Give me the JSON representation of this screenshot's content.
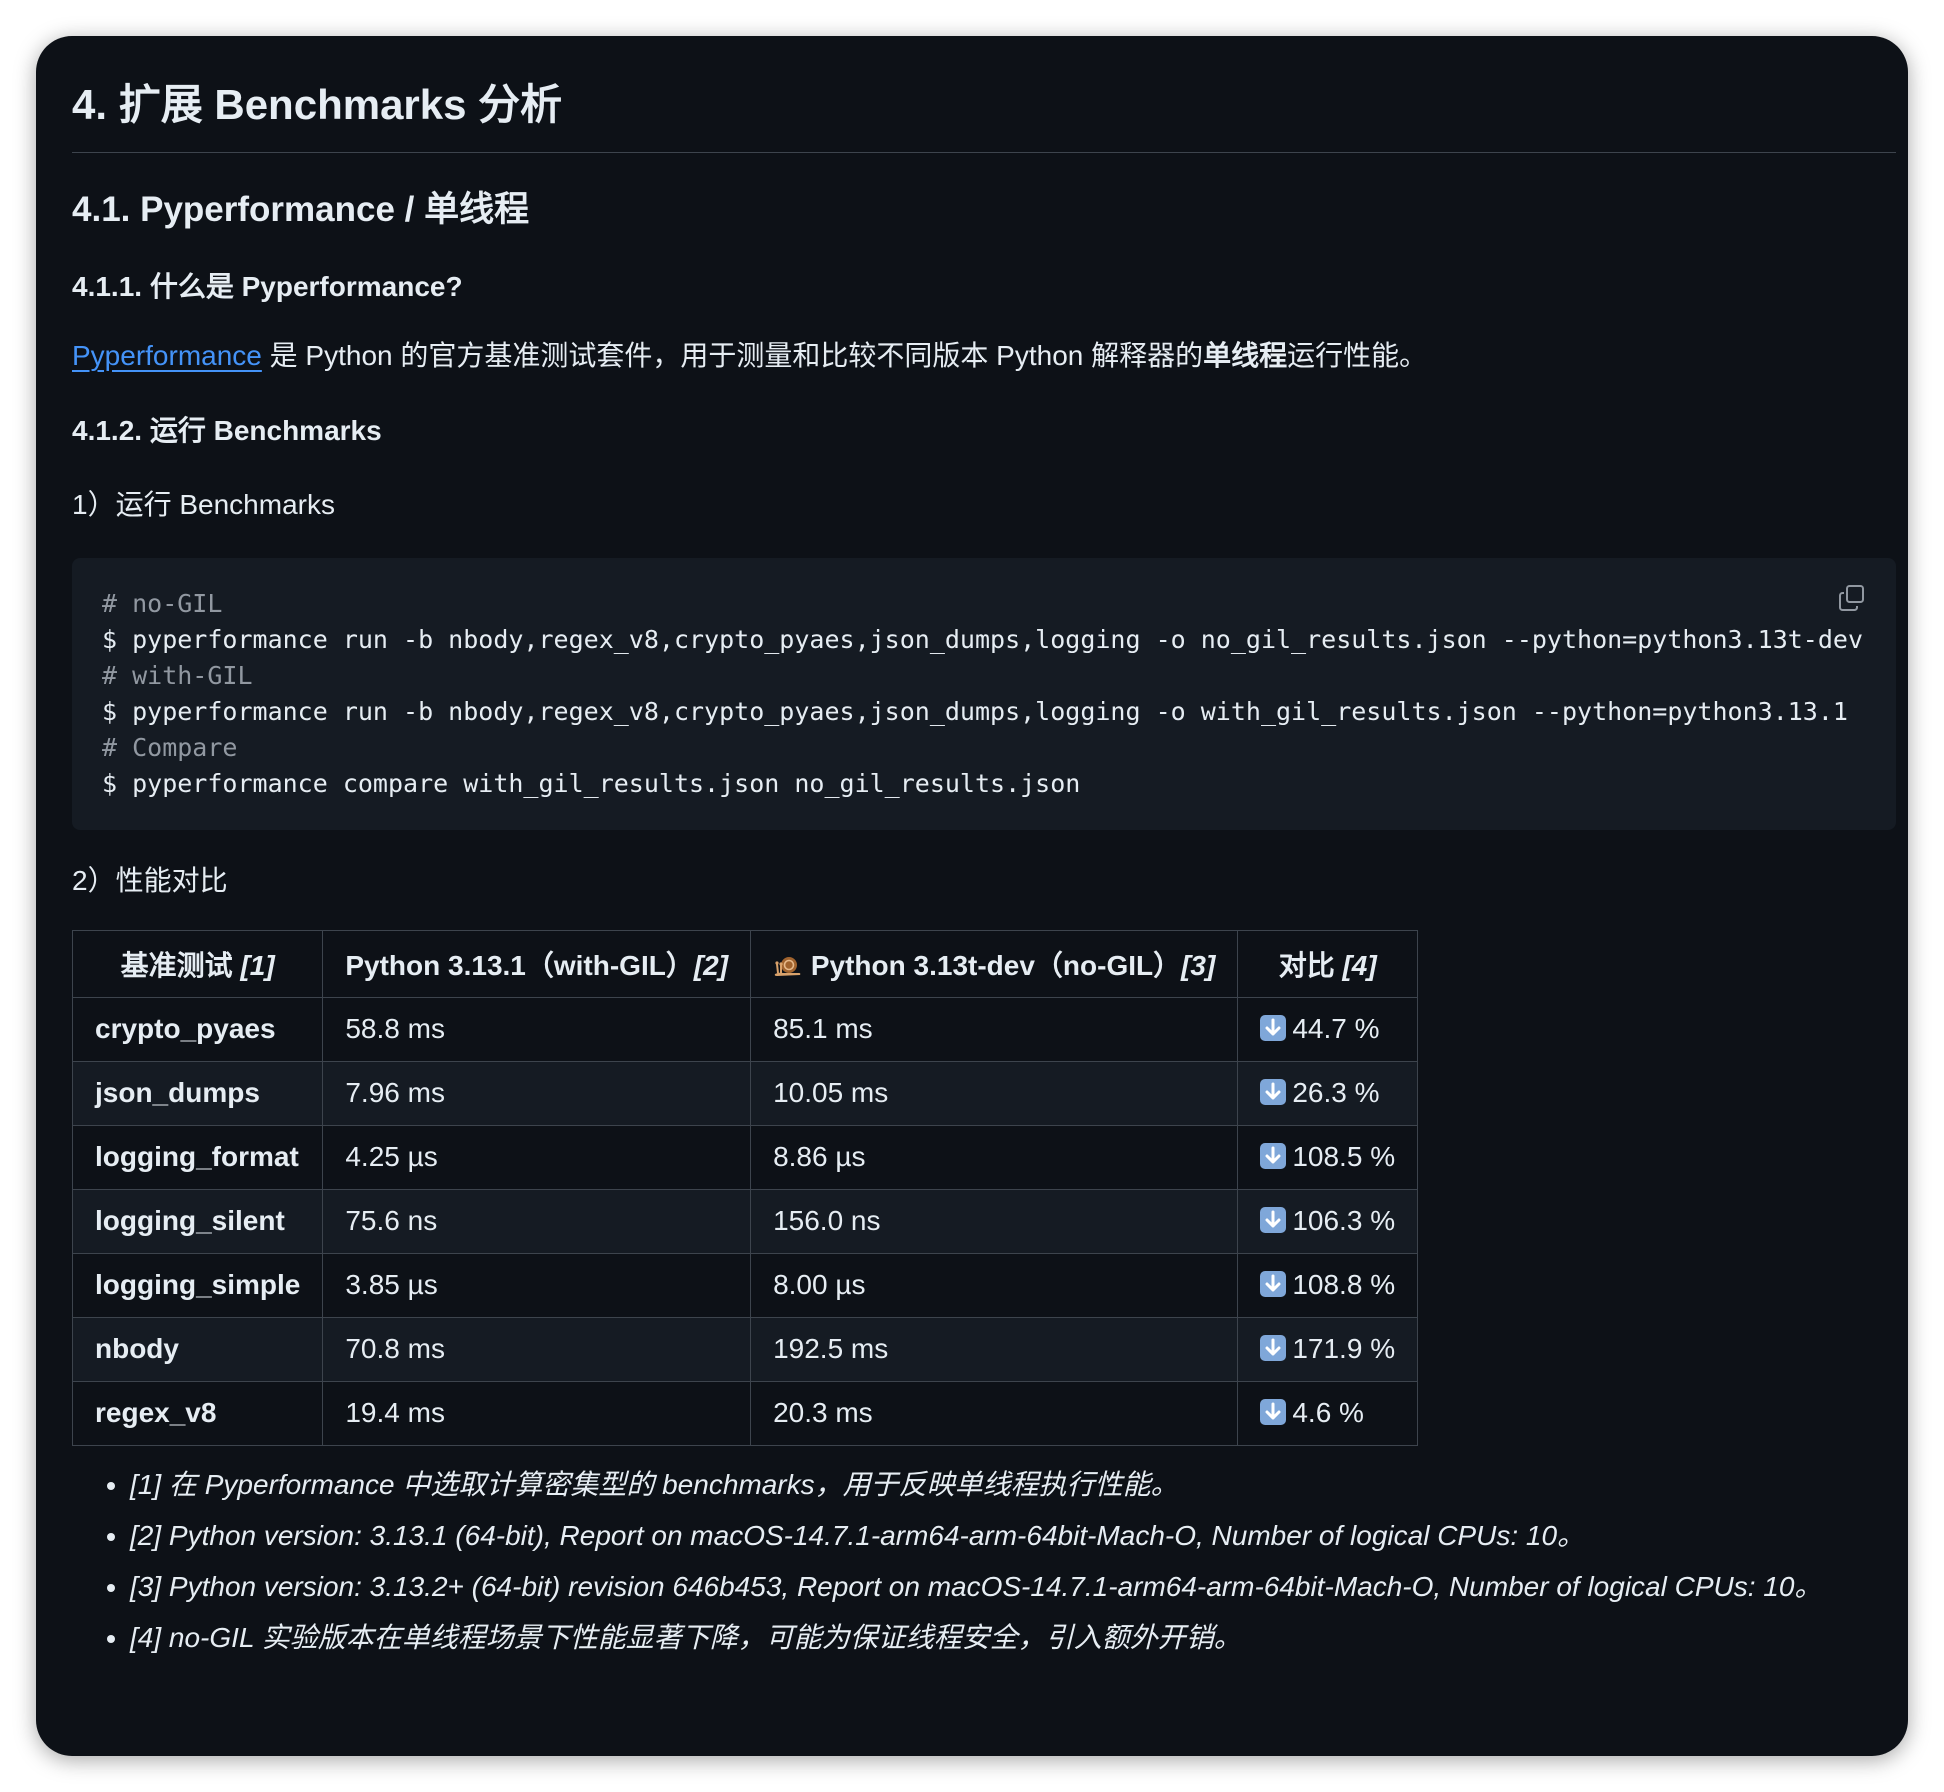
{
  "h1": "4. 扩展 Benchmarks 分析",
  "h2": "4.1. Pyperformance / 单线程",
  "h3_what": "4.1.1. 什么是 Pyperformance?",
  "intro": {
    "link": "Pyperformance",
    "text_a": " 是 Python 的官方基准测试套件，用于测量和比较不同版本 Python 解释器的",
    "bold": "单线程",
    "text_b": "运行性能。"
  },
  "h3_run": "4.1.2. 运行 Benchmarks",
  "step1": "1）运行 Benchmarks",
  "code": [
    "# no-GIL",
    "$ pyperformance run -b nbody,regex_v8,crypto_pyaes,json_dumps,logging -o no_gil_results.json --python=python3.13t-dev",
    "# with-GIL",
    "$ pyperformance run -b nbody,regex_v8,crypto_pyaes,json_dumps,logging -o with_gil_results.json --python=python3.13.1",
    "# Compare",
    "$ pyperformance compare with_gil_results.json no_gil_results.json"
  ],
  "step2": "2）性能对比",
  "table": {
    "headers": [
      {
        "text": "基准测试 ",
        "ref": "[1]"
      },
      {
        "text": "Python 3.13.1（with-GIL）",
        "ref": "[2]"
      },
      {
        "text": "Python 3.13t-dev（no-GIL）",
        "ref": "[3]"
      },
      {
        "text": "对比 ",
        "ref": "[4]"
      }
    ],
    "rows": [
      [
        "crypto_pyaes",
        "58.8 ms",
        "85.1 ms",
        "44.7 %"
      ],
      [
        "json_dumps",
        "7.96 ms",
        "10.05 ms",
        "26.3 %"
      ],
      [
        "logging_format",
        "4.25 µs",
        "8.86 µs",
        "108.5 %"
      ],
      [
        "logging_silent",
        "75.6 ns",
        "156.0 ns",
        "106.3 %"
      ],
      [
        "logging_simple",
        "3.85 µs",
        "8.00 µs",
        "108.8 %"
      ],
      [
        "nbody",
        "70.8 ms",
        "192.5 ms",
        "171.9 %"
      ],
      [
        "regex_v8",
        "19.4 ms",
        "20.3 ms",
        "4.6 %"
      ]
    ]
  },
  "notes": [
    "[1] 在 Pyperformance 中选取计算密集型的 benchmarks，用于反映单线程执行性能。",
    "[2] Python version: 3.13.1 (64-bit), Report on macOS-14.7.1-arm64-arm-64bit-Mach-O, Number of logical CPUs: 10。",
    "[3] Python version: 3.13.2+ (64-bit) revision 646b453, Report on macOS-14.7.1-arm64-arm-64bit-Mach-O, Number of logical CPUs: 10。",
    "[4] no-GIL 实验版本在单线程场景下性能显著下降，可能为保证线程安全，引入额外开销。"
  ],
  "icons": {
    "copy": "copy-icon",
    "trend": "down-arrow-icon",
    "header": "snail-icon"
  },
  "colors": {
    "background": "#0d1117",
    "code_bg": "#151b23",
    "link": "#4493f8",
    "border": "#3d444d"
  }
}
